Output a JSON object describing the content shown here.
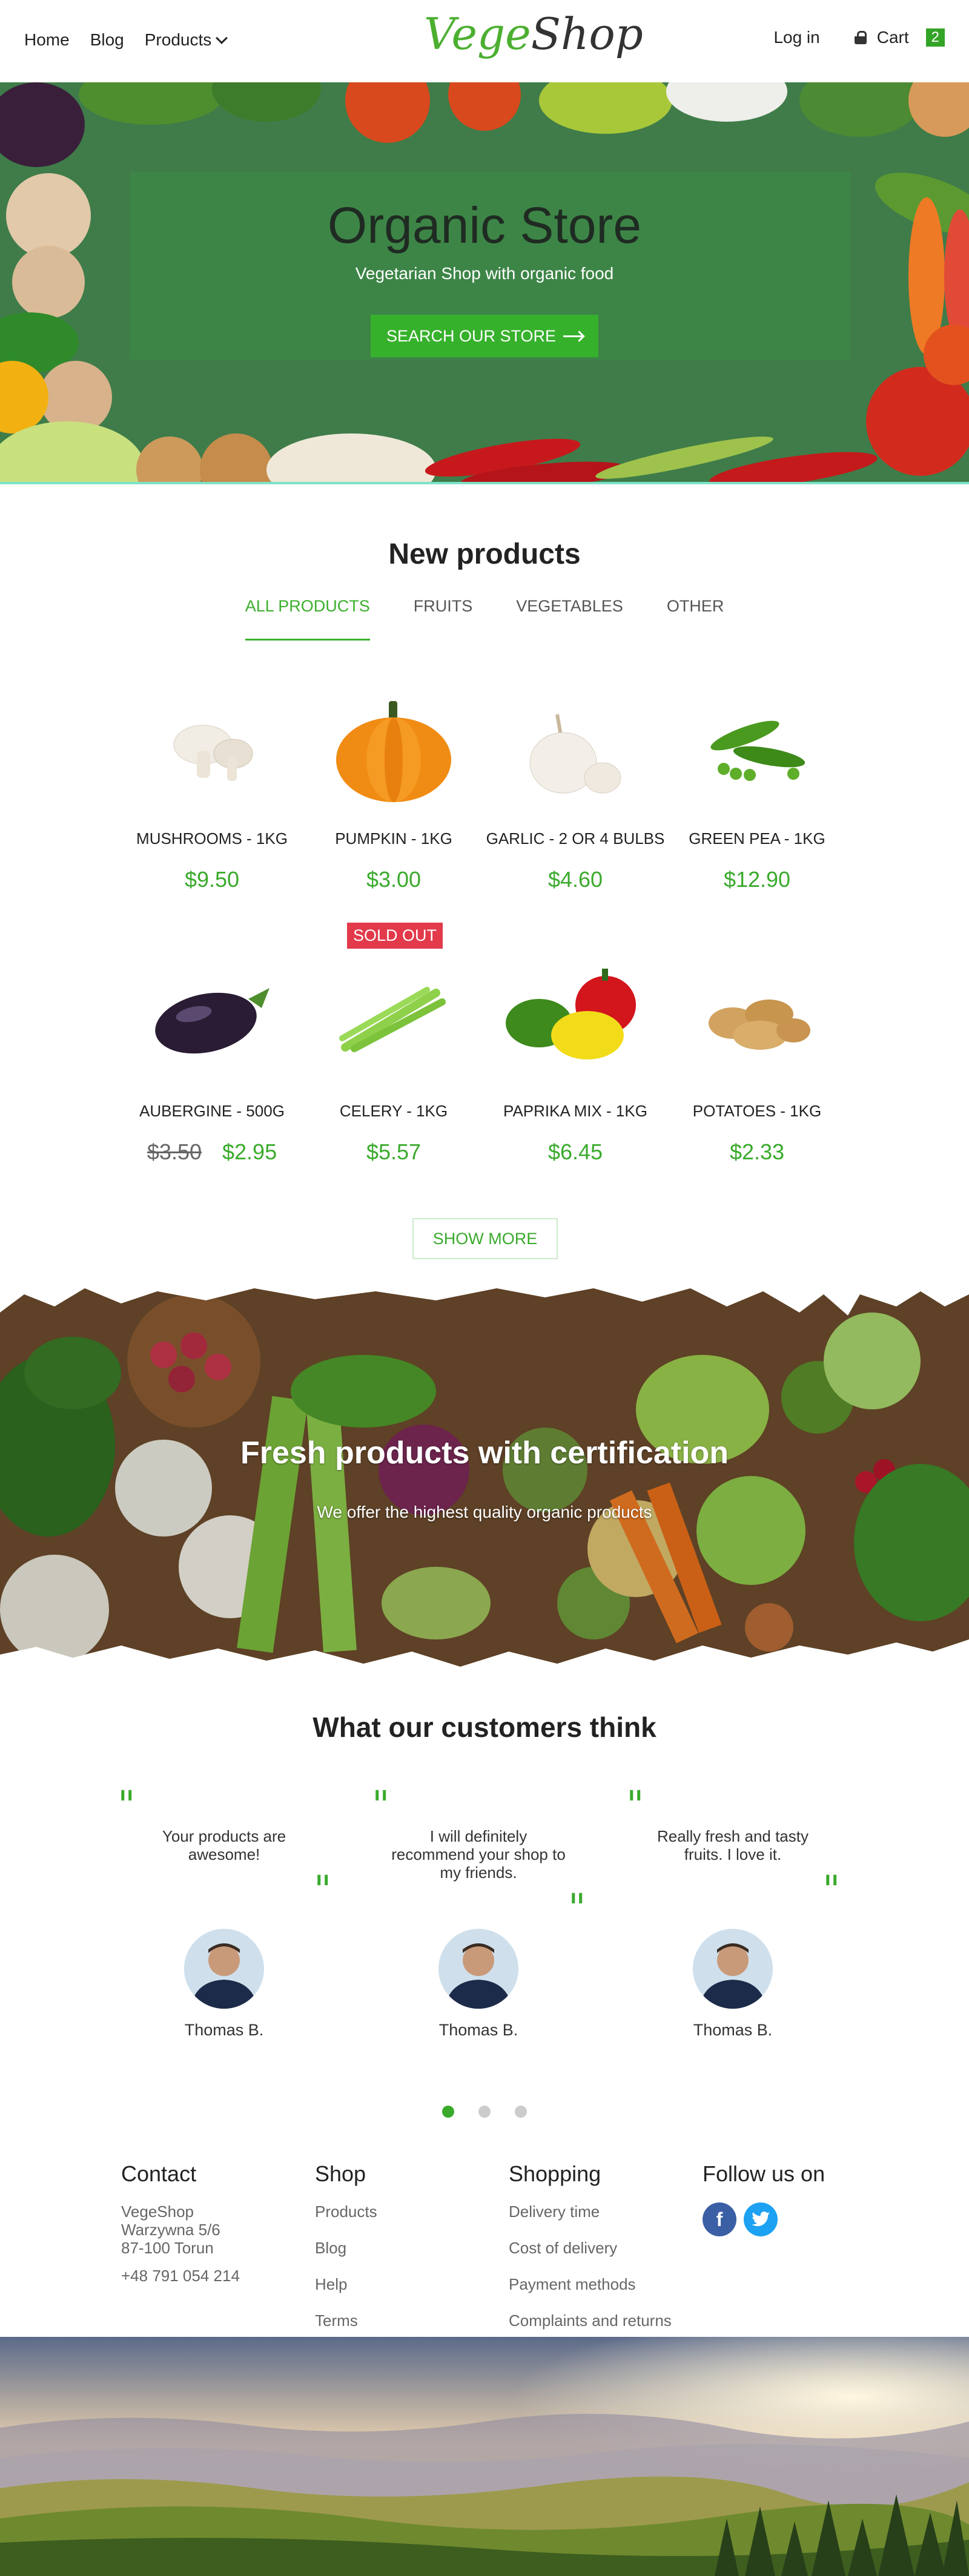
{
  "header": {
    "nav": [
      "Home",
      "Blog",
      "Products"
    ],
    "logo_part1": "Vege",
    "logo_part2": "Shop",
    "login": "Log in",
    "cart_label": "Cart",
    "cart_count": "2"
  },
  "hero": {
    "title": "Organic Store",
    "subtitle": "Vegetarian Shop with organic food",
    "button": "SEARCH OUR STORE"
  },
  "new_products": {
    "title": "New products",
    "tabs": [
      "ALL PRODUCTS",
      "FRUITS",
      "VEGETABLES",
      "OTHER"
    ],
    "active_tab": "ALL PRODUCTS",
    "items": [
      {
        "name": "MUSHROOMS - 1KG",
        "price": "$9.50"
      },
      {
        "name": "PUMPKIN - 1KG",
        "price": "$3.00"
      },
      {
        "name": "GARLIC - 2 OR 4 BULBS",
        "price": "$4.60"
      },
      {
        "name": "GREEN PEA - 1KG",
        "price": "$12.90"
      },
      {
        "name": "AUBERGINE - 500G",
        "old_price": "$3.50",
        "price": "$2.95"
      },
      {
        "name": "CELERY - 1KG",
        "price": "$5.57",
        "badge": "SOLD OUT"
      },
      {
        "name": "PAPRIKA MIX - 1KG",
        "price": "$6.45"
      },
      {
        "name": "POTATOES - 1KG",
        "price": "$2.33"
      }
    ],
    "show_more": "SHOW MORE"
  },
  "fresh": {
    "title": "Fresh products with certification",
    "subtitle": "We offer the highest quality organic products"
  },
  "testimonials": {
    "title": "What our customers think",
    "items": [
      {
        "text": "Your products are awesome!",
        "name": "Thomas B."
      },
      {
        "text": "I will definitely recommend your shop to my friends.",
        "name": "Thomas B."
      },
      {
        "text": "Really fresh and tasty fruits. I love it.",
        "name": "Thomas B."
      }
    ]
  },
  "footer": {
    "contact": {
      "title": "Contact",
      "lines": [
        "VegeShop",
        "Warzywna 5/6",
        "87-100 Torun"
      ],
      "phone": "+48 791 054 214"
    },
    "shop": {
      "title": "Shop",
      "links": [
        "Products",
        "Blog",
        "Help",
        "Terms"
      ]
    },
    "shopping": {
      "title": "Shopping",
      "links": [
        "Delivery time",
        "Cost of delivery",
        "Payment methods",
        "Complaints and returns"
      ]
    },
    "follow": {
      "title": "Follow us on",
      "icons": [
        "facebook-icon",
        "twitter-icon"
      ]
    }
  },
  "colors": {
    "accent": "#3aaa2c",
    "sold_out": "#e23a4b",
    "facebook": "#3b5fa5",
    "twitter": "#1da1f2"
  }
}
